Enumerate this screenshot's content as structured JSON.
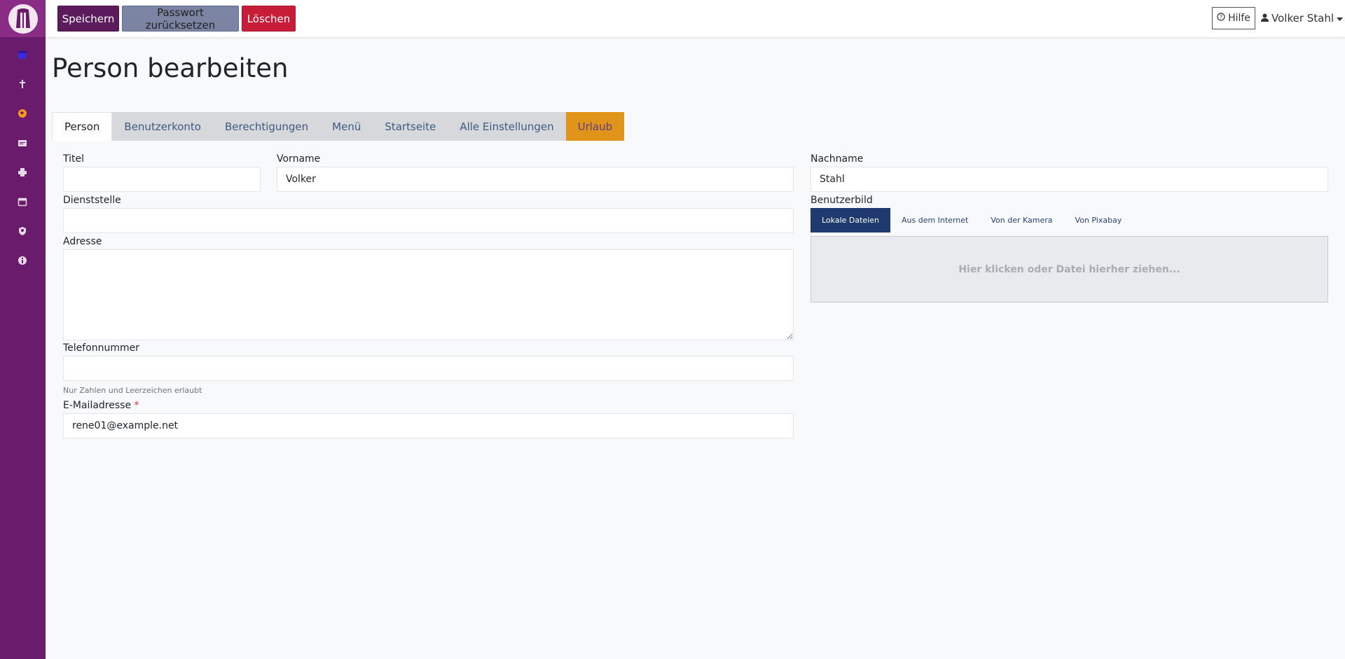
{
  "sidebar": {
    "logo": "app-logo",
    "nav_items": [
      {
        "icon": "calendar-icon",
        "color": "#3b2bd6"
      },
      {
        "icon": "cross-icon",
        "color": "#e8d9e8"
      },
      {
        "icon": "globe-icon",
        "color": "#f29a1f"
      },
      {
        "icon": "card-icon",
        "color": "#e8d9e8"
      },
      {
        "icon": "printer-icon",
        "color": "#e8d9e8"
      },
      {
        "icon": "calendar-outline-icon",
        "color": "#e8d9e8"
      },
      {
        "icon": "user-shield-icon",
        "color": "#e8d9e8"
      },
      {
        "icon": "info-icon",
        "color": "#e8d9e8"
      }
    ]
  },
  "toolbar": {
    "save_label": "Speichern",
    "reset_password_label": "Passwort zurücksetzen",
    "delete_label": "Löschen",
    "help_label": "Hilfe",
    "user_name": "Volker Stahl"
  },
  "page": {
    "title": "Person bearbeiten"
  },
  "tabs": [
    "Person",
    "Benutzerkonto",
    "Berechtigungen",
    "Menü",
    "Startseite",
    "Alle Einstellungen",
    "Urlaub"
  ],
  "form": {
    "titel_label": "Titel",
    "titel_value": "",
    "vorname_label": "Vorname",
    "vorname_value": "Volker",
    "nachname_label": "Nachname",
    "nachname_value": "Stahl",
    "dienststelle_label": "Dienststelle",
    "dienststelle_value": "",
    "adresse_label": "Adresse",
    "adresse_value": "",
    "telefon_label": "Telefonnummer",
    "telefon_value": "",
    "telefon_hint": "Nur Zahlen und Leerzeichen erlaubt",
    "email_label": "E-Mailadresse",
    "email_required": "*",
    "email_value": "rene01@example.net",
    "benutzerbild_label": "Benutzerbild"
  },
  "image_tabs": [
    "Lokale Dateien",
    "Aus dem Internet",
    "Von der Kamera",
    "Von Pixabay"
  ],
  "dropzone_text": "Hier klicken oder Datei hierher ziehen..."
}
